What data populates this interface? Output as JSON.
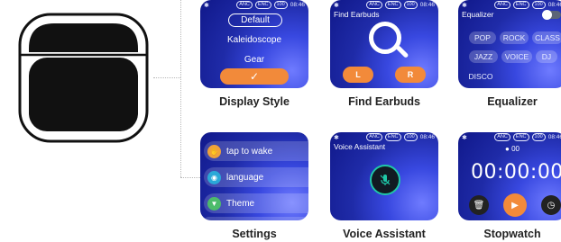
{
  "status": {
    "bluetooth": "✱",
    "anc": "ANC",
    "enc": "ENC",
    "battery": "100",
    "time": "08:46"
  },
  "display_style": {
    "options": [
      "Default",
      "Kaleidoscope",
      "Gear"
    ],
    "confirm_icon": "check-icon",
    "caption": "Display Style"
  },
  "find_earbuds": {
    "title": "Find Earbuds",
    "left_label": "L",
    "right_label": "R",
    "caption": "Find Earbuds"
  },
  "equalizer": {
    "title": "Equalizer",
    "enabled": true,
    "presets": [
      "POP",
      "ROCK",
      "CLASS",
      "JAZZ",
      "VOICE",
      "DJ",
      "DISCO"
    ],
    "caption": "Equalizer"
  },
  "settings": {
    "items": [
      {
        "label": "tap to wake",
        "icon": "hand-icon",
        "color": "#f0a23a"
      },
      {
        "label": "language",
        "icon": "globe-icon",
        "color": "#2aa8d8"
      },
      {
        "label": "Theme",
        "icon": "shirt-icon",
        "color": "#4dbb6b"
      }
    ],
    "caption": "Settings"
  },
  "voice_assistant": {
    "title": "Voice Assistant",
    "caption": "Voice Assistant"
  },
  "stopwatch": {
    "lap": "00",
    "time": "00:00:00",
    "caption": "Stopwatch"
  },
  "colors": {
    "accent": "#f28a3a",
    "screen_bg": "#1f2ba8",
    "mic_ring": "#1fc7a7"
  }
}
